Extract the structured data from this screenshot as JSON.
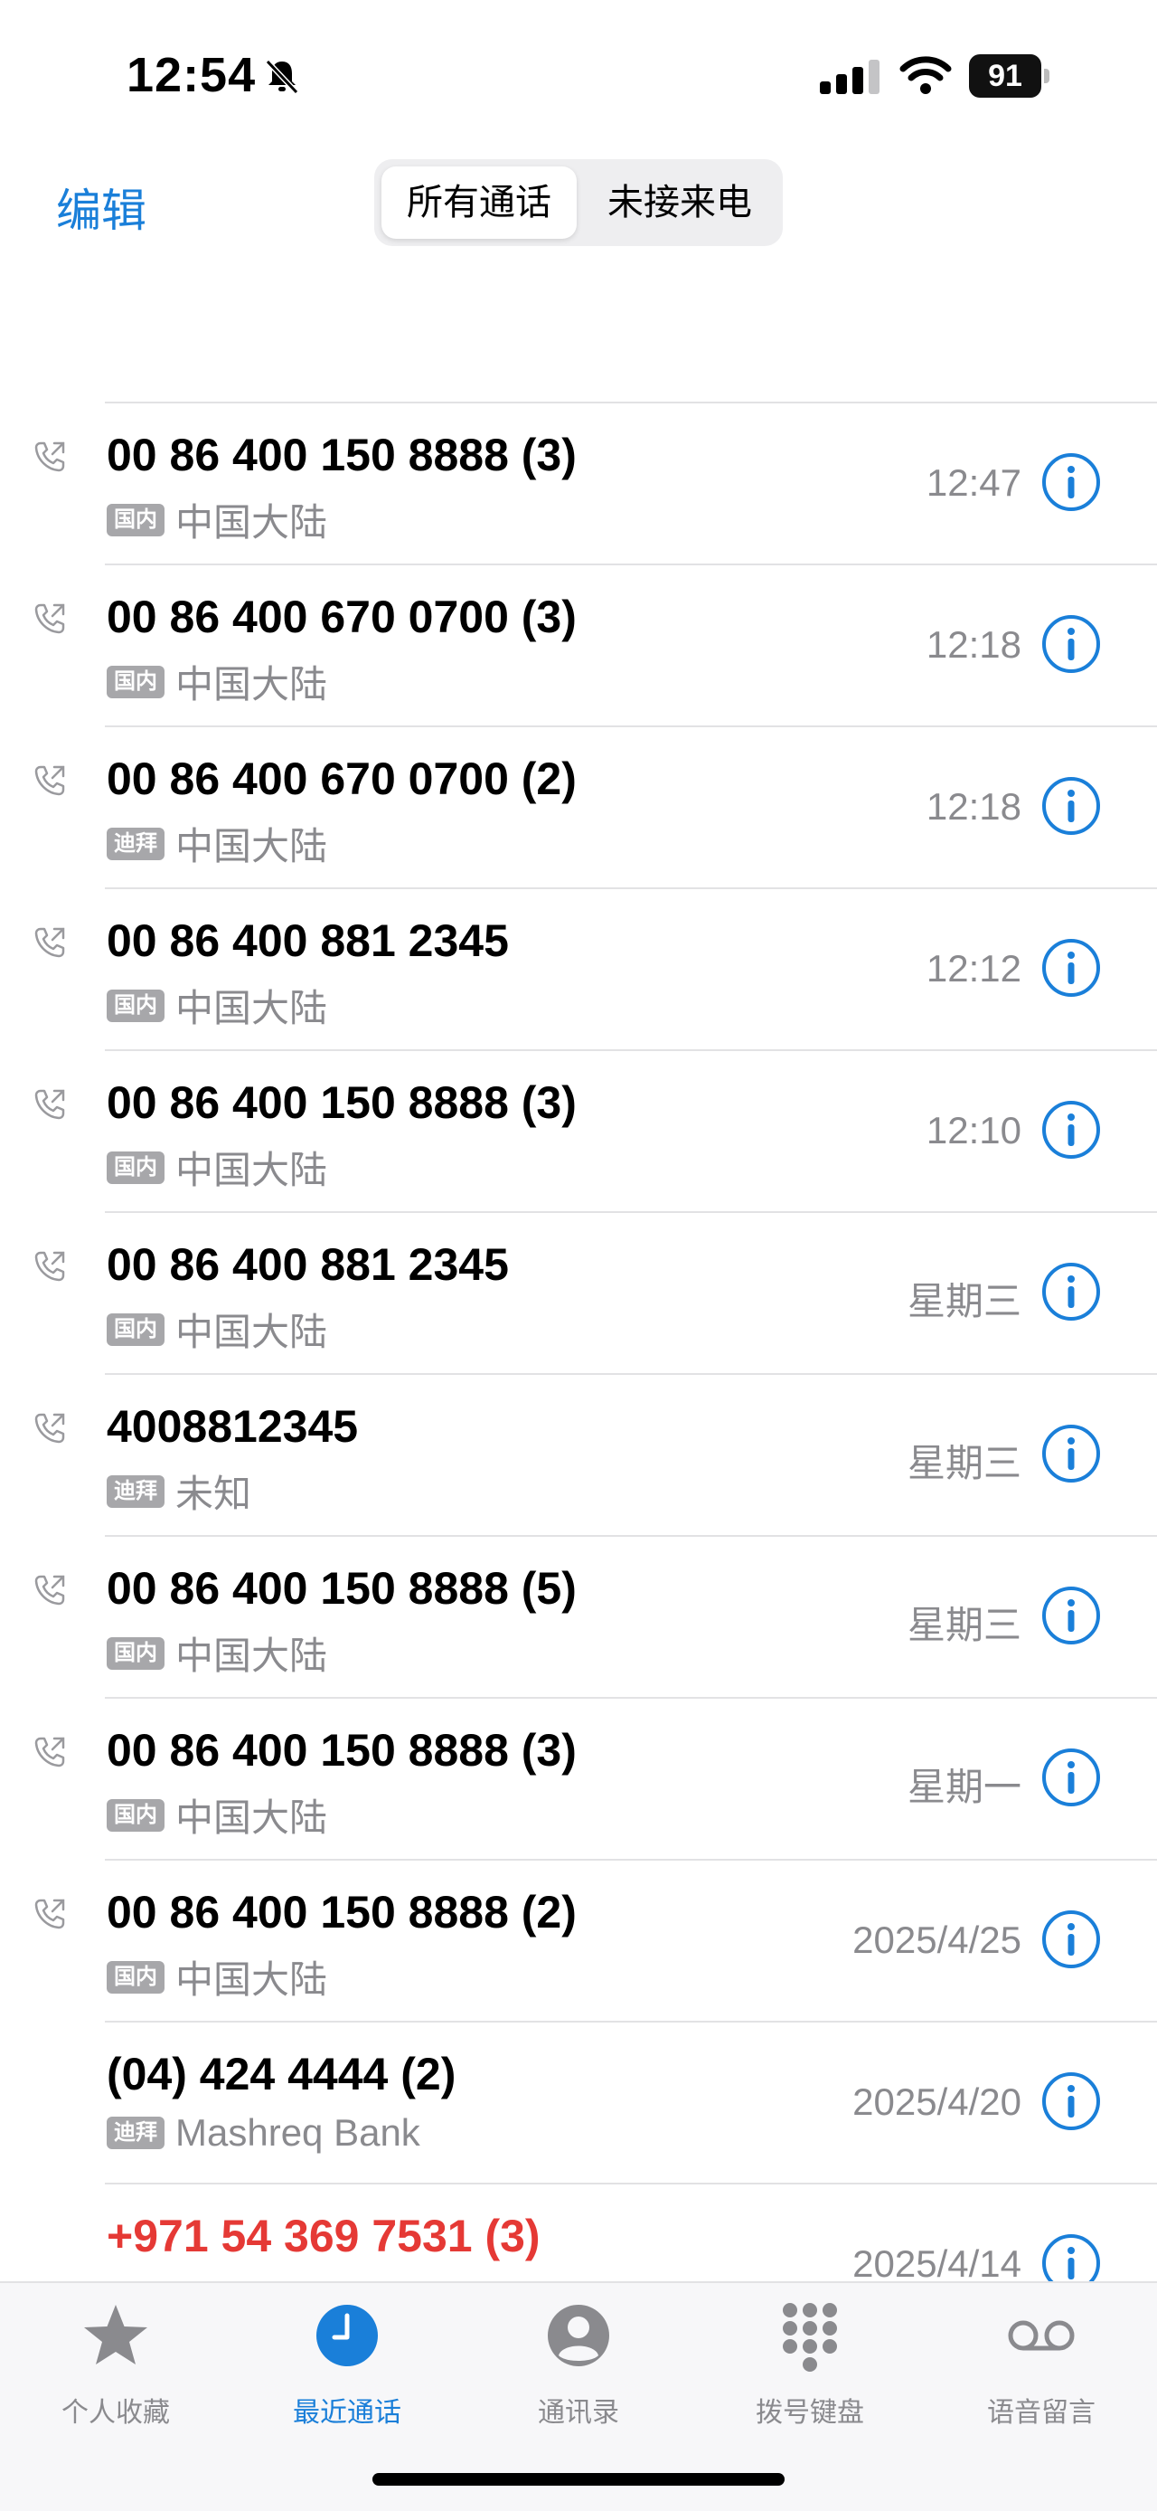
{
  "status": {
    "time": "12:54",
    "battery": "91"
  },
  "header": {
    "edit": "编辑",
    "segments": [
      "所有通话",
      "未接来电"
    ]
  },
  "calls": [
    {
      "name": "00 86 400 150 8888 (3)",
      "badge": "国内",
      "location": "中国大陆",
      "time": "12:47",
      "missed": false,
      "outgoing": true
    },
    {
      "name": "00 86 400 670 0700 (3)",
      "badge": "国内",
      "location": "中国大陆",
      "time": "12:18",
      "missed": false,
      "outgoing": true
    },
    {
      "name": "00 86 400 670 0700 (2)",
      "badge": "迪拜",
      "location": "中国大陆",
      "time": "12:18",
      "missed": false,
      "outgoing": true
    },
    {
      "name": "00 86 400 881 2345",
      "badge": "国内",
      "location": "中国大陆",
      "time": "12:12",
      "missed": false,
      "outgoing": true
    },
    {
      "name": "00 86 400 150 8888 (3)",
      "badge": "国内",
      "location": "中国大陆",
      "time": "12:10",
      "missed": false,
      "outgoing": true
    },
    {
      "name": "00 86 400 881 2345",
      "badge": "国内",
      "location": "中国大陆",
      "time": "星期三",
      "missed": false,
      "outgoing": true
    },
    {
      "name": "4008812345",
      "badge": "迪拜",
      "location": "未知",
      "time": "星期三",
      "missed": false,
      "outgoing": true
    },
    {
      "name": "00 86 400 150 8888 (5)",
      "badge": "国内",
      "location": "中国大陆",
      "time": "星期三",
      "missed": false,
      "outgoing": true
    },
    {
      "name": "00 86 400 150 8888 (3)",
      "badge": "国内",
      "location": "中国大陆",
      "time": "星期一",
      "missed": false,
      "outgoing": true
    },
    {
      "name": "00 86 400 150 8888 (2)",
      "badge": "国内",
      "location": "中国大陆",
      "time": "2025/4/25",
      "missed": false,
      "outgoing": true
    },
    {
      "name": "(04) 424 4444 (2)",
      "badge": "迪拜",
      "location": "Mashreq Bank",
      "time": "2025/4/20",
      "missed": false,
      "outgoing": false
    },
    {
      "name": "+971 54 369 7531 (3)",
      "badge": "",
      "location": "",
      "time": "2025/4/14",
      "missed": true,
      "outgoing": false
    }
  ],
  "tabs": [
    {
      "label": "个人收藏",
      "icon": "star-icon",
      "active": false
    },
    {
      "label": "最近通话",
      "icon": "clock-icon",
      "active": true
    },
    {
      "label": "通讯录",
      "icon": "person-icon",
      "active": false
    },
    {
      "label": "拨号键盘",
      "icon": "keypad-icon",
      "active": false
    },
    {
      "label": "语音留言",
      "icon": "voicemail-icon",
      "active": false
    }
  ],
  "colors": {
    "accent": "#1a7fd9",
    "missed": "#e53935",
    "secondary": "#8a8a8e"
  }
}
